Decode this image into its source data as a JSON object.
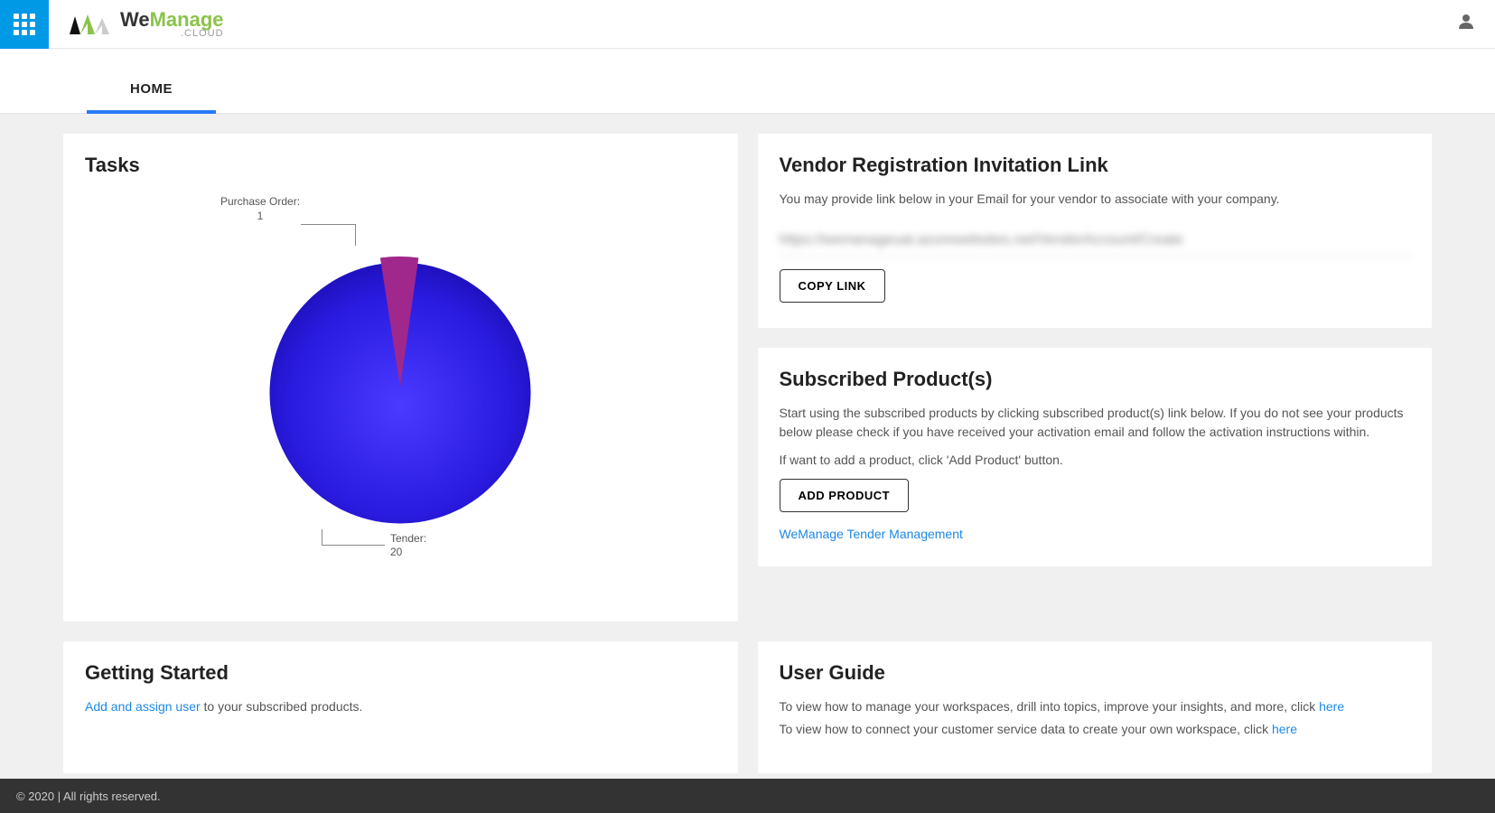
{
  "header": {
    "brand_primary": "We",
    "brand_secondary": "Manage",
    "brand_sub": ".CLOUD"
  },
  "tabs": {
    "home": "HOME"
  },
  "tasks": {
    "title": "Tasks"
  },
  "chart_data": {
    "type": "pie",
    "title": "Tasks",
    "slices": [
      {
        "label": "Purchase Order:",
        "value": 1,
        "color": "#a0288c"
      },
      {
        "label": "Tender:",
        "value": 20,
        "color": "#2a1be0"
      }
    ]
  },
  "vendor": {
    "title": "Vendor Registration Invitation Link",
    "desc": "You may provide link below in your Email for your vendor to associate with your company.",
    "link_blurred": "https://wemanageuat.azurewebsites.net/VendorAccount/Create",
    "copy_btn": "COPY LINK"
  },
  "subscribed": {
    "title": "Subscribed Product(s)",
    "desc1": "Start using the subscribed products by clicking subscribed product(s) link below. If you do not see your products below please check if you have received your activation email and follow the activation instructions within.",
    "desc2": "If want to add a product, click 'Add Product' button.",
    "add_btn": "ADD PRODUCT",
    "product_link": "WeManage Tender Management"
  },
  "getting_started": {
    "title": "Getting Started",
    "link_text": "Add and assign user",
    "rest_text": " to your subscribed products."
  },
  "user_guide": {
    "title": "User Guide",
    "line1_pre": "To view how to manage your workspaces, drill into topics, improve your insights, and more, click ",
    "line1_link": "here",
    "line2_pre": "To view how to connect your customer service data to create your own workspace, click ",
    "line2_link": "here"
  },
  "footer": {
    "text": "© 2020 | All rights reserved."
  }
}
